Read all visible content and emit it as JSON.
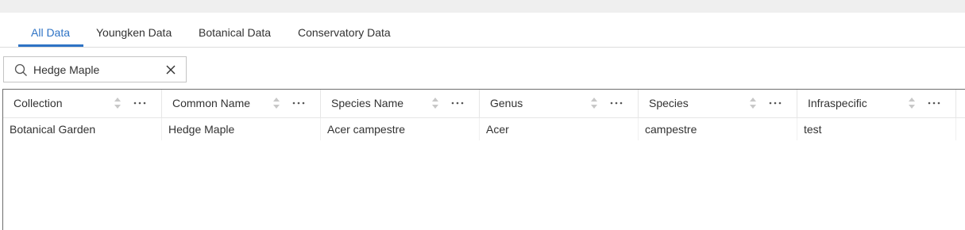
{
  "tabs": [
    {
      "label": "All Data",
      "active": true
    },
    {
      "label": "Youngken Data",
      "active": false
    },
    {
      "label": "Botanical Data",
      "active": false
    },
    {
      "label": "Conservatory Data",
      "active": false
    }
  ],
  "search": {
    "value": "Hedge Maple",
    "icon": "search-icon",
    "clear_icon": "close-icon"
  },
  "table": {
    "columns": [
      "Collection",
      "Common Name",
      "Species Name",
      "Genus",
      "Species",
      "Infraspecific"
    ],
    "rows": [
      [
        "Botanical Garden",
        "Hedge Maple",
        "Acer campestre",
        "Acer",
        "campestre",
        "test"
      ]
    ]
  },
  "colors": {
    "accent": "#2e73c5",
    "text": "#323232",
    "border": "#6e6e6e"
  }
}
